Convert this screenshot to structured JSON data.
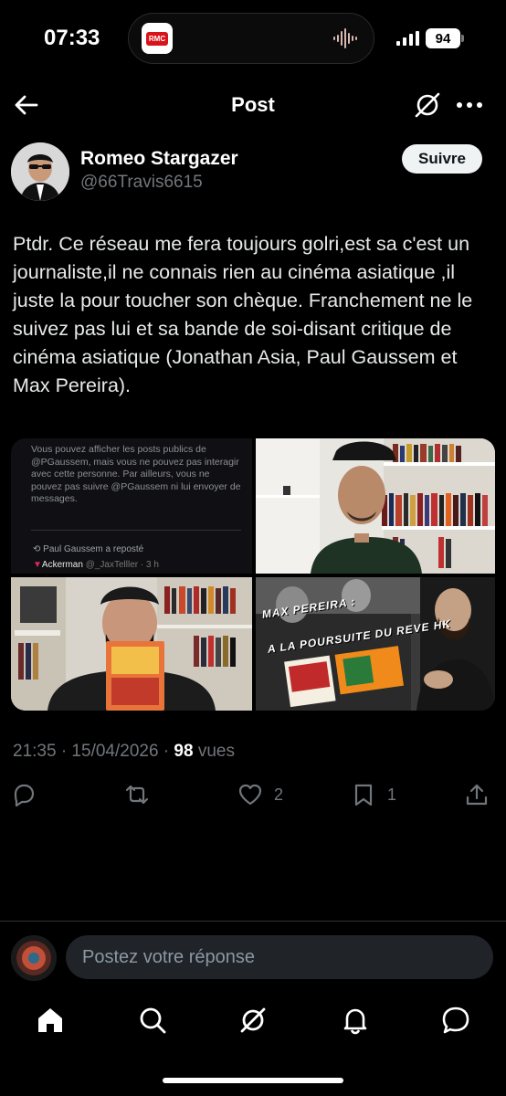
{
  "status": {
    "time": "07:33",
    "battery": "94",
    "app_badge": "RMC"
  },
  "header": {
    "title": "Post"
  },
  "author": {
    "name": "Romeo Stargazer",
    "handle": "@66Travis6615",
    "follow_label": "Suivre"
  },
  "post": {
    "text": "Ptdr. Ce réseau me fera toujours golri,est sa c'est un journaliste,il ne connais rien au cinéma asiatique ,il juste la pour toucher son chèque. Franchement ne le suivez pas lui et sa bande de soi-disant critique de cinéma asiatique (Jonathan Asia, Paul Gaussem et Max Pereira).",
    "media": {
      "screenshot_text": "Vous pouvez afficher les posts publics de @PGaussem, mais vous ne pouvez pas interagir avec cette personne. Par ailleurs, vous ne pouvez pas suivre @PGaussem ni lui envoyer de messages.",
      "repost_label": "Paul Gaussem a reposté",
      "repost_name": "Ackerman",
      "repost_handle": "@_JaxTelller · 3 h",
      "video_title_line1": "MAX PEREIRA :",
      "video_title_line2": "A LA POURSUITE DU REVE HK"
    },
    "time": "21:35 · 15/04/2026 · ",
    "views_count": "98",
    "views_label": " vues"
  },
  "actions": {
    "like_count": "2",
    "bookmark_count": "1"
  },
  "reply": {
    "placeholder": "Postez votre réponse"
  },
  "colors": {
    "background": "#000000",
    "text": "#e7e9ea",
    "muted": "#71767b",
    "input_bg": "#202327"
  }
}
